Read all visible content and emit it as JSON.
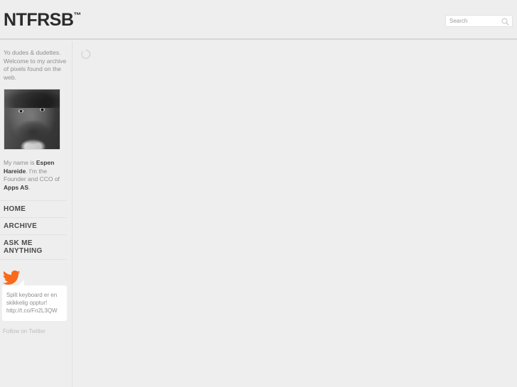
{
  "header": {
    "logo_text": "NTFRSB",
    "logo_trademark": "™",
    "search": {
      "placeholder": "Search",
      "value": "",
      "icon": "search-icon"
    }
  },
  "sidebar": {
    "intro": "Yo dudes & dudettes. Welcome to my archive of pixels found on the web.",
    "avatar_alt": "Black and white portrait photo",
    "bio": {
      "prefix": "My name is ",
      "name": "Espen Hareide",
      "middle": ". I'm the Founder and CCO of ",
      "company": "Apps AS",
      "suffix": "."
    },
    "nav": [
      {
        "label": "HOME",
        "name": "sidebar-item-home"
      },
      {
        "label": "ARCHIVE",
        "name": "sidebar-item-archive"
      },
      {
        "label": "ASK ME ANYTHING",
        "name": "sidebar-item-ask-me-anything"
      }
    ],
    "twitter": {
      "icon": "twitter-bird-icon",
      "tweet_text": "Spilt keyboard er en skikkelig opptur!",
      "tweet_url": "http://t.co/Fn2L3QW",
      "follow_label": "Follow on Twitter"
    }
  },
  "main": {
    "loading_icon": "loading-spinner-icon"
  },
  "colors": {
    "page_background": "#eeeeee",
    "header_border": "#d7d7d7",
    "sidebar_border": "#e0e0e0",
    "twitter_orange": "#f96a1b",
    "logo_text": "#2b2b2b",
    "body_text": "#8e8e8e",
    "nav_text": "#4a4a4a"
  }
}
